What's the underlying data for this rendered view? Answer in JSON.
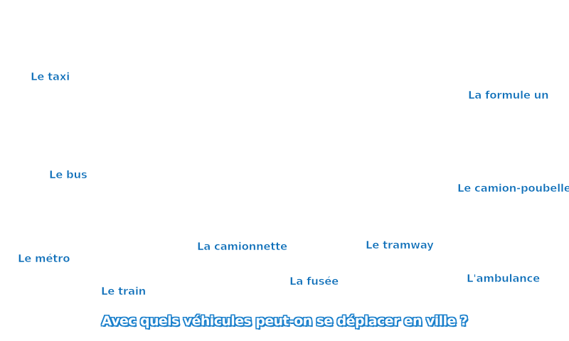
{
  "words": {
    "taxi": "Le taxi",
    "formule": "La formule un",
    "bus": "Le bus",
    "camion": "Le camion-poubelle",
    "camionnette": "La camionnette",
    "tramway": "Le tramway",
    "metro": "Le métro",
    "fusee": "La fusée",
    "ambulance": "L'ambulance",
    "train": "Le train"
  },
  "question": "Avec quels véhicules peut-on se déplacer en ville ?",
  "colors": {
    "word_text": "#0b6db8",
    "question_outline": "#1b80cc",
    "background": "#ffffff"
  }
}
